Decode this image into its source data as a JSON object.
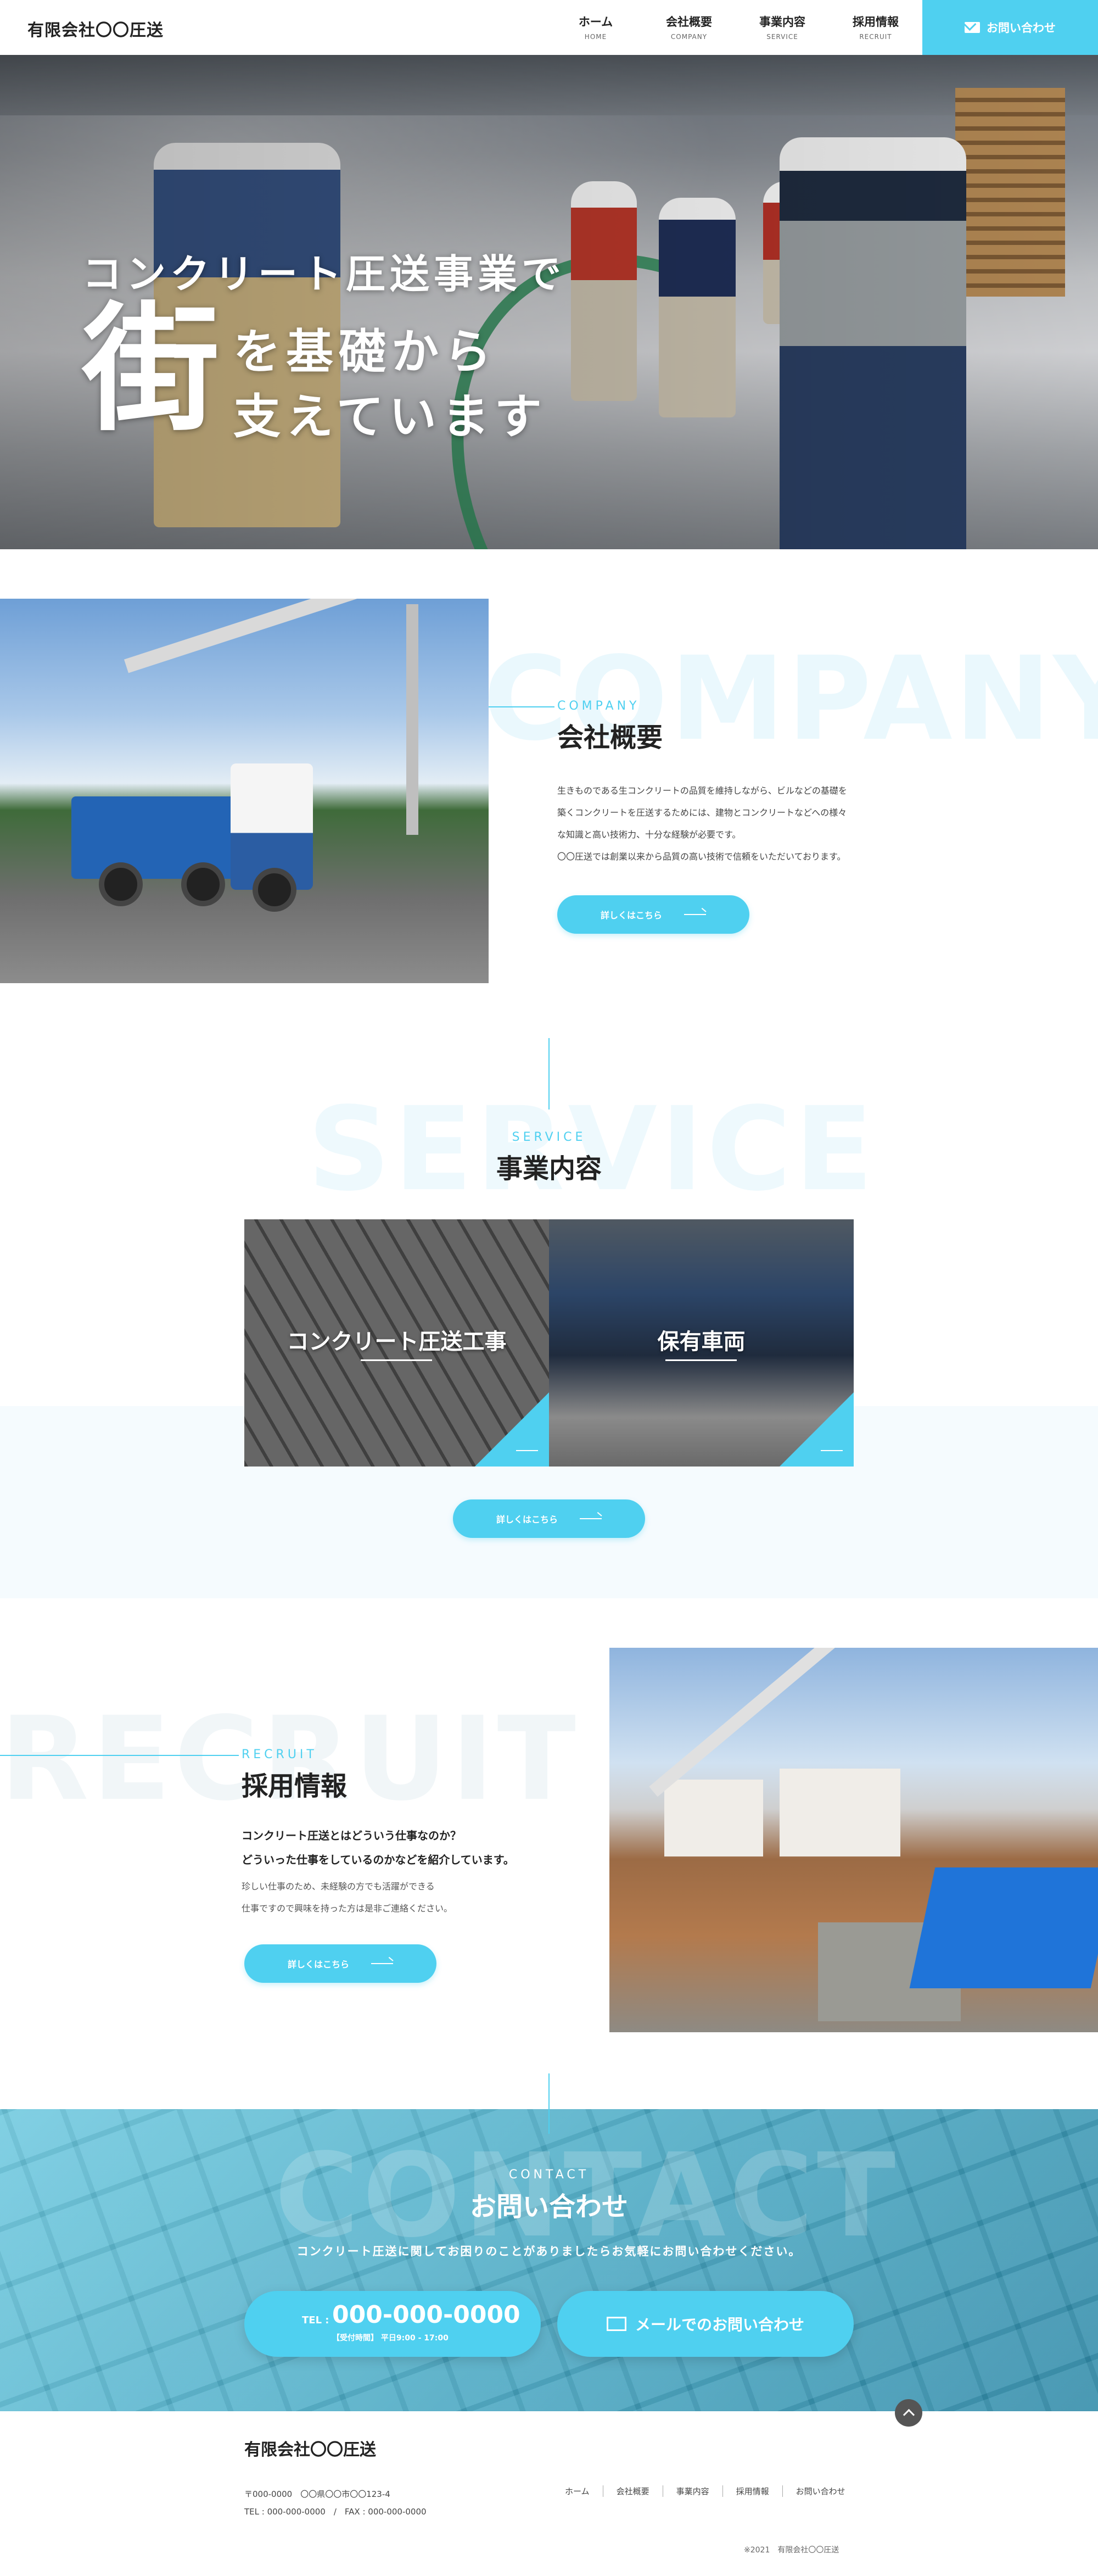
{
  "header": {
    "logo": "有限会社〇〇圧送",
    "nav": [
      {
        "jp": "ホーム",
        "en": "HOME"
      },
      {
        "jp": "会社概要",
        "en": "COMPANY"
      },
      {
        "jp": "事業内容",
        "en": "SERVICE"
      },
      {
        "jp": "採用情報",
        "en": "RECRUIT"
      }
    ],
    "contact_label": "お問い合わせ"
  },
  "hero": {
    "line1": "コンクリート圧送事業で",
    "big_char": "街",
    "line2": "を基礎から",
    "line3": "支えています"
  },
  "company": {
    "ghost": "COMPANY",
    "en": "COMPANY",
    "jp": "会社概要",
    "text": [
      "生きものである生コンクリートの品質を維持しながら、ビルなどの基礎を",
      "築くコンクリートを圧送するためには、建物とコンクリートなどへの様々",
      "な知識と高い技術力、十分な経験が必要です。",
      "〇〇圧送では創業以来から品質の高い技術で信頼をいただいております。"
    ],
    "button": "詳しくはこちら"
  },
  "service": {
    "ghost": "SERVICE",
    "en": "SERVICE",
    "jp": "事業内容",
    "cards": [
      {
        "title": "コンクリート圧送工事"
      },
      {
        "title": "保有車両"
      }
    ],
    "button": "詳しくはこちら"
  },
  "recruit": {
    "ghost": "RECRUIT",
    "en": "RECRUIT",
    "jp": "採用情報",
    "lead": [
      "コンクリート圧送とはどういう仕事なのか？",
      "どういった仕事をしているのかなどを紹介しています。"
    ],
    "text": [
      "珍しい仕事のため、未経験の方でも活躍ができる",
      "仕事ですので興味を持った方は是非ご連絡ください。"
    ],
    "button": "詳しくはこちら"
  },
  "contact": {
    "ghost": "CONTACT",
    "en": "CONTACT",
    "jp": "お問い合わせ",
    "lead": "コンクリート圧送に関してお困りのことがありましたらお気軽にお問い合わせください。",
    "tel_prefix": "TEL :",
    "tel_number": "000-000-0000",
    "tel_hours": "【受付時間】 平日9:00 - 17:00",
    "mail_label": "メールでのお問い合わせ"
  },
  "footer": {
    "logo": "有限会社〇〇圧送",
    "address": "〒000-0000　〇〇県〇〇市〇〇123-4",
    "telfax": "TEL : 000-000-0000　/　FAX : 000-000-0000",
    "nav": [
      "ホーム",
      "会社概要",
      "事業内容",
      "採用情報",
      "お問い合わせ"
    ],
    "copyright": "※2021　有限会社〇〇圧送"
  },
  "colors": {
    "accent": "#4fd0f0",
    "text": "#222222",
    "contact_bg": "#4aa9c4"
  }
}
